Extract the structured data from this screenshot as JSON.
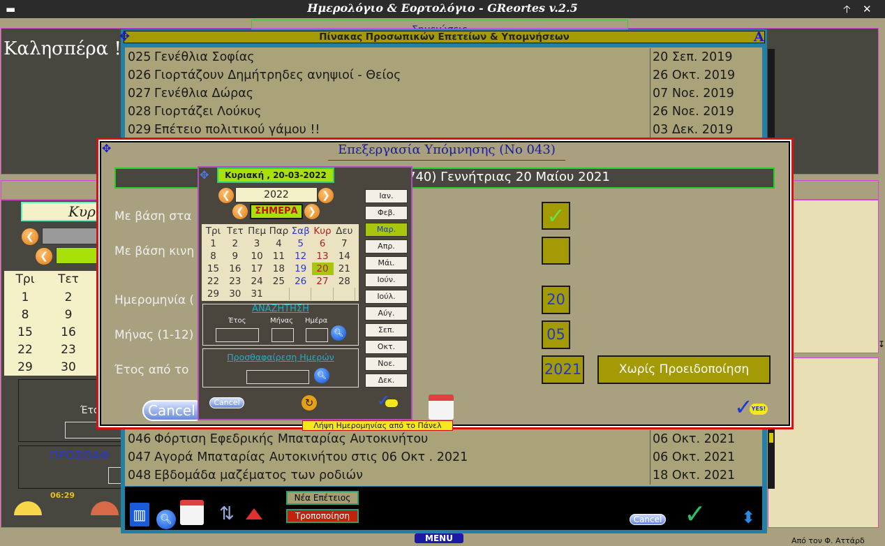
{
  "window": {
    "title": "Ημερολόγιο & Εορτολόγιο - GReortes v.2.5",
    "footer_credit": "Από τον Φ. Αττάρδ"
  },
  "main": {
    "greeting": "Καλησπέρα !",
    "notes_tab": "Σημειώσεις",
    "day_header": "Κυρ",
    "time": "06:29",
    "menu_label": "MENU",
    "search_label": "Έτος",
    "add_label": "ΠΡΟΣΘΑΦ",
    "week_days": [
      "Τρι",
      "Τετ"
    ],
    "week_rows": [
      [
        "1",
        "2"
      ],
      [
        "8",
        "9"
      ],
      [
        "15",
        "16"
      ],
      [
        "22",
        "23"
      ],
      [
        "29",
        "30"
      ]
    ]
  },
  "anniversaries": {
    "title": "Πίνακας Προσωπικών Επετείων & Υπομνήσεων",
    "corner_letter": "A",
    "rows": [
      {
        "no": "025",
        "text": "Γενέθλια Σοφίας",
        "date": "20 Σεπ. 2019"
      },
      {
        "no": "026",
        "text": "Γιορτάζουν Δημήτρηδες ανηψιοί - Θείος",
        "date": "26 Οκτ. 2019"
      },
      {
        "no": "027",
        "text": "Γενέθλια Δώρας",
        "date": "07 Νοε. 2019"
      },
      {
        "no": "028",
        "text": "Γιορτάζει Λούκυς",
        "date": "26 Νοε. 2019"
      },
      {
        "no": "029",
        "text": "Επέτειο πολιτικού γάμου !!",
        "date": "03 Δεκ. 2019"
      }
    ],
    "rows_bottom": [
      {
        "no": "046",
        "text": "Φόρτιση Εφεδρικής Μπαταρίας Αυτοκινήτου",
        "date": "06 Οκτ. 2021"
      },
      {
        "no": "047",
        "text": "Αγορά Μπαταρίας Αυτοκινήτου στις 06 Οκτ . 2021",
        "date": "06 Οκτ. 2021"
      },
      {
        "no": "048",
        "text": "Εβδομάδα μαζέματος των ροδιών",
        "date": "18 Οκτ. 2021"
      }
    ],
    "new_button": "Νέα Επέτειος",
    "edit_button": "Τροποποίηση",
    "cancel_button": "Cancel"
  },
  "edit_dialog": {
    "title": "Επεξεργασία Υπόμνησης (Νο 043)",
    "record_text": "740) Γεννήτριας 20 Μαίου 2021",
    "label_static": "Με βάση στα",
    "label_movable": "Με βάση κινη",
    "label_date": "Ημερομηνία (",
    "label_month": "Μήνας (1-12)",
    "label_year": "Έτος από το",
    "day_value": "20",
    "month_value": "05",
    "year_value": "2021",
    "warning_button": "Χωρίς Προειδοποίηση",
    "cancel_button": "Cancel",
    "tooltip": "Λήψη Ημερομηνίας από το Πάνελ",
    "yes_label": "YES!"
  },
  "calendar": {
    "date_header": "Κυριακή , 20-03-2022",
    "year": "2022",
    "today": "ΣΗΜΕΡΑ",
    "day_headers": [
      "Τρι",
      "Τετ",
      "Πεμ",
      "Παρ",
      "Σαβ",
      "Κυρ",
      "Δευ"
    ],
    "weeks": [
      [
        "1",
        "2",
        "3",
        "4",
        "5",
        "6",
        "7"
      ],
      [
        "8",
        "9",
        "10",
        "11",
        "12",
        "13",
        "14"
      ],
      [
        "15",
        "16",
        "17",
        "18",
        "19",
        "20",
        "21"
      ],
      [
        "22",
        "23",
        "24",
        "25",
        "26",
        "27",
        "28"
      ],
      [
        "29",
        "30",
        "31",
        "",
        "",
        "",
        ""
      ]
    ],
    "selected_day": "20",
    "months": [
      "Ιαν.",
      "Φεβ.",
      "Μαρ.",
      "Απρ.",
      "Μάι.",
      "Ιούν.",
      "Ιούλ.",
      "Αύγ.",
      "Σεπ.",
      "Οκτ.",
      "Νοε.",
      "Δεκ."
    ],
    "selected_month": "Μαρ.",
    "search_title": "ΑΝΑΖΗΤΗΣΗ",
    "year_label": "Έτος",
    "month_label": "Μήνας",
    "day_label": "Ημέρα",
    "add_days_title": "Προσθαφαίρεση Ημερών",
    "cancel_button": "Cancel"
  },
  "colors": {
    "olive": "#a39a06",
    "panel": "#47463f",
    "accent_red": "#cc0000",
    "selected": "#a8c60e"
  }
}
